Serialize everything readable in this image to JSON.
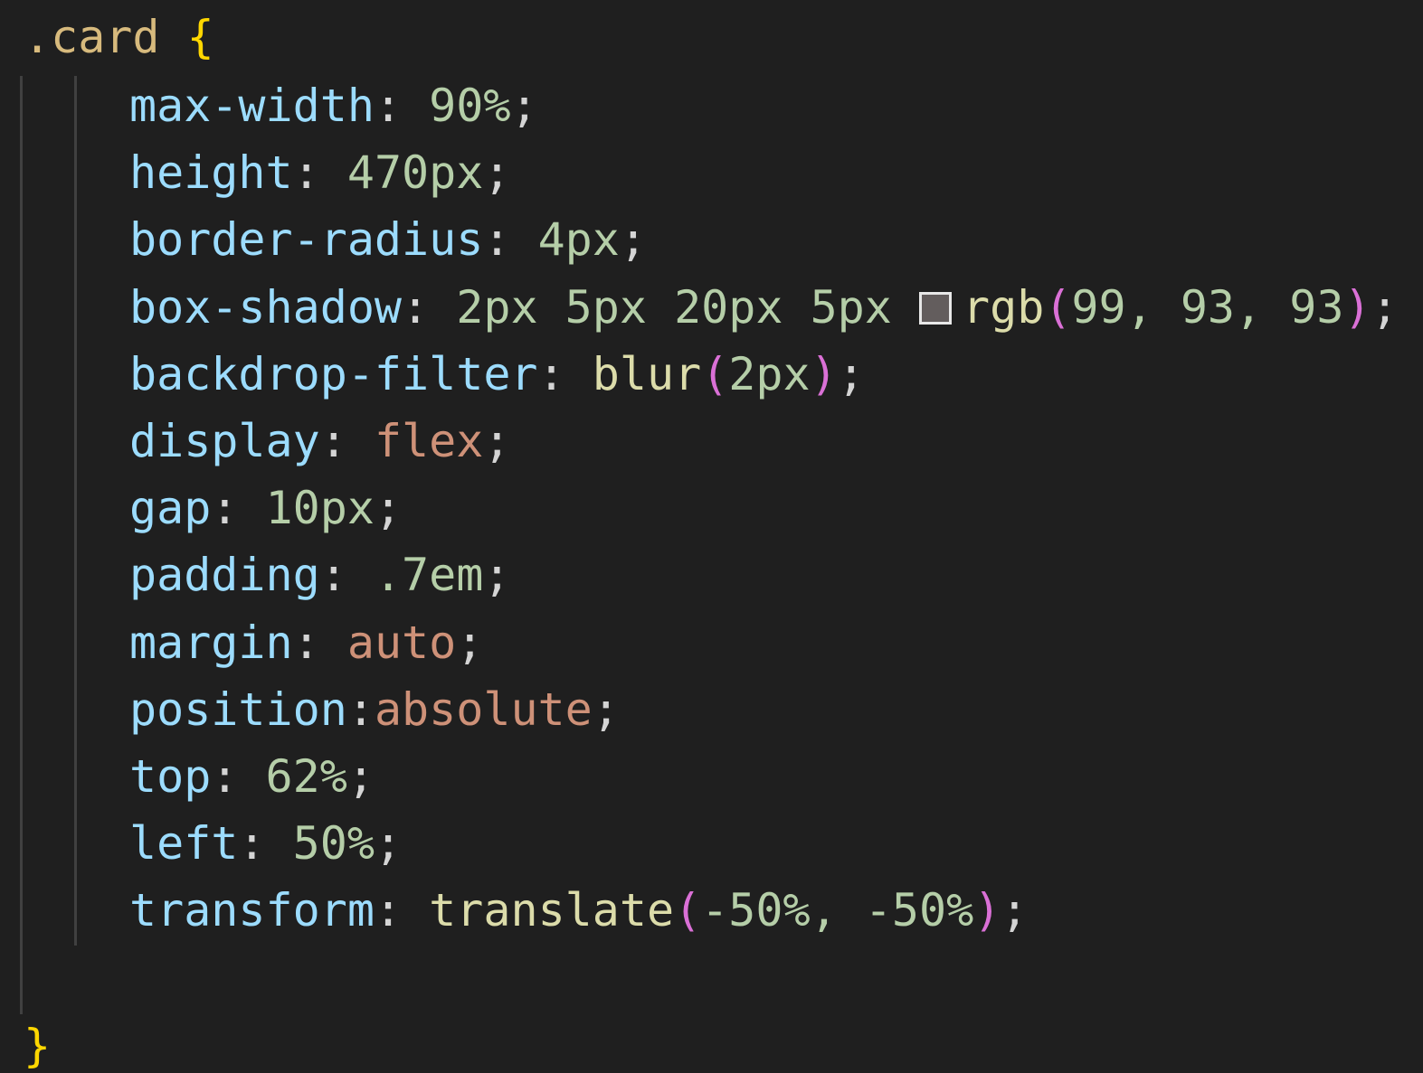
{
  "editor": {
    "selector": ".card",
    "open_brace": "{",
    "close_brace": "}",
    "declarations": [
      {
        "prop": "max-width",
        "sep": ": ",
        "parts": [
          {
            "t": "num",
            "v": "90%"
          }
        ]
      },
      {
        "prop": "height",
        "sep": ": ",
        "parts": [
          {
            "t": "num",
            "v": "470px"
          }
        ]
      },
      {
        "prop": "border-radius",
        "sep": ": ",
        "parts": [
          {
            "t": "num",
            "v": "4px"
          }
        ]
      },
      {
        "prop": "box-shadow",
        "sep": ": ",
        "parts": [
          {
            "t": "num",
            "v": "2px 5px 20px 5px "
          },
          {
            "t": "swatch",
            "color": "#635d5d"
          },
          {
            "t": "fn",
            "v": "rgb"
          },
          {
            "t": "paren",
            "v": "("
          },
          {
            "t": "num",
            "v": "99, 93, 93"
          },
          {
            "t": "paren",
            "v": ")"
          }
        ]
      },
      {
        "prop": "backdrop-filter",
        "sep": ": ",
        "parts": [
          {
            "t": "fn",
            "v": "blur"
          },
          {
            "t": "paren",
            "v": "("
          },
          {
            "t": "num",
            "v": "2px"
          },
          {
            "t": "paren",
            "v": ")"
          }
        ]
      },
      {
        "prop": "display",
        "sep": ": ",
        "parts": [
          {
            "t": "kw",
            "v": "flex"
          }
        ]
      },
      {
        "prop": "gap",
        "sep": ": ",
        "parts": [
          {
            "t": "num",
            "v": "10px"
          }
        ]
      },
      {
        "prop": "padding",
        "sep": ": ",
        "parts": [
          {
            "t": "num",
            "v": ".7em"
          }
        ]
      },
      {
        "prop": "margin",
        "sep": ": ",
        "parts": [
          {
            "t": "kw",
            "v": "auto"
          }
        ]
      },
      {
        "prop": "position",
        "sep": ":",
        "parts": [
          {
            "t": "kw",
            "v": "absolute"
          }
        ]
      },
      {
        "prop": "top",
        "sep": ": ",
        "parts": [
          {
            "t": "num",
            "v": "62%"
          }
        ]
      },
      {
        "prop": "left",
        "sep": ": ",
        "parts": [
          {
            "t": "num",
            "v": "50%"
          }
        ]
      },
      {
        "prop": "transform",
        "sep": ": ",
        "parts": [
          {
            "t": "fn",
            "v": "translate"
          },
          {
            "t": "paren",
            "v": "("
          },
          {
            "t": "num",
            "v": "-50%, -50%"
          },
          {
            "t": "paren",
            "v": ")"
          }
        ]
      }
    ]
  },
  "theme": {
    "background": "#1f1f1f",
    "selector": "#d7ba7d",
    "brace": "#ffd700",
    "property": "#9cdcfe",
    "number": "#b5cea8",
    "keyword": "#ce9178",
    "function": "#dcdcaa",
    "paren": "#da70d6"
  }
}
